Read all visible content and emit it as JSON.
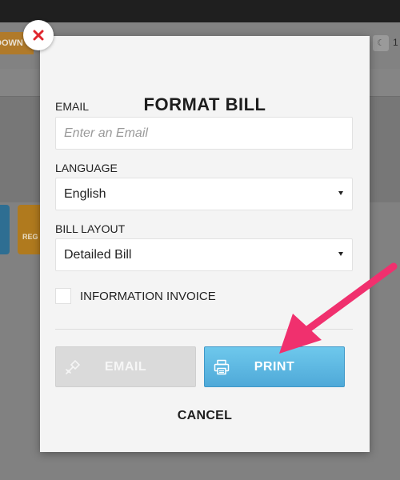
{
  "background": {
    "orange_button_label": "DOWN",
    "tile_label": "REG",
    "right_status": "1"
  },
  "modal": {
    "title": "FORMAT BILL",
    "email": {
      "label": "EMAIL",
      "value": "",
      "placeholder": "Enter an Email"
    },
    "language": {
      "label": "LANGUAGE",
      "selected": "English"
    },
    "bill_layout": {
      "label": "BILL LAYOUT",
      "selected": "Detailed Bill"
    },
    "information_invoice": {
      "label": "INFORMATION INVOICE",
      "checked": false
    },
    "buttons": {
      "email": "EMAIL",
      "print": "PRINT",
      "cancel": "CANCEL"
    }
  },
  "icons": {
    "close": "close-icon",
    "email": "email-icon",
    "print": "printer-icon",
    "moon": "moon-icon"
  },
  "colors": {
    "close_x": "#e0262d",
    "print_button": "#5ab6e0",
    "email_button_disabled": "#dadada",
    "annotation_arrow": "#f0306e"
  }
}
